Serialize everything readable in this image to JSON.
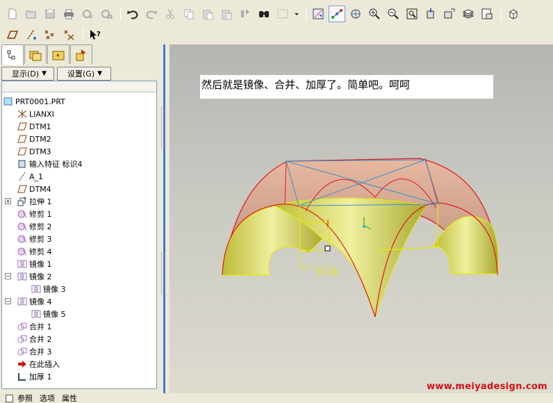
{
  "toolbar": {
    "row1": [
      "new-icon",
      "open-icon",
      "save-icon",
      "print-icon",
      "send-icon",
      "email-icon",
      "undo-icon",
      "redo-icon",
      "cut-icon",
      "copy-icon",
      "paste-icon",
      "paste-special-icon",
      "regenerate-icon",
      "find-icon",
      "select-box-icon",
      "repaint-icon",
      "spin-center-icon",
      "orient-icon",
      "zoom-in-icon",
      "zoom-out-icon",
      "refit-icon",
      "reorient-icon",
      "saved-views-icon",
      "layers-icon",
      "model-tree-icon",
      "window-icon"
    ],
    "row2": [
      "datum-plane-icon",
      "datum-axis-icon",
      "datum-point-icon",
      "coordinate-system-icon",
      "context-help-icon"
    ]
  },
  "left_panel": {
    "tabs": [
      "model-tree-tab",
      "folder-browser-tab",
      "favorites-tab",
      "connections-tab"
    ],
    "show_menu": "显示(D)",
    "settings_menu": "设置(G)",
    "tree": [
      {
        "label": "PRT0001.PRT",
        "icon": "part-icon",
        "indent": 0
      },
      {
        "label": "LIANXI",
        "icon": "csys-icon",
        "indent": 1
      },
      {
        "label": "DTM1",
        "icon": "datum-plane-icon",
        "indent": 1
      },
      {
        "label": "DTM2",
        "icon": "datum-plane-icon",
        "indent": 1
      },
      {
        "label": "DTM3",
        "icon": "datum-plane-icon",
        "indent": 1
      },
      {
        "label": "输入特征 标识4",
        "icon": "import-feature-icon",
        "indent": 1
      },
      {
        "label": "A_1",
        "icon": "datum-axis-icon",
        "indent": 1
      },
      {
        "label": "DTM4",
        "icon": "datum-plane-icon",
        "indent": 1
      },
      {
        "label": "拉伸 1",
        "icon": "extrude-icon",
        "indent": 1,
        "expander": "+"
      },
      {
        "label": "修剪 1",
        "icon": "trim-icon",
        "indent": 1
      },
      {
        "label": "修剪 2",
        "icon": "trim-icon",
        "indent": 1
      },
      {
        "label": "修剪 3",
        "icon": "trim-icon",
        "indent": 1
      },
      {
        "label": "修剪 4",
        "icon": "trim-icon",
        "indent": 1
      },
      {
        "label": "镜像 1",
        "icon": "mirror-icon",
        "indent": 1
      },
      {
        "label": "镜像 2",
        "icon": "mirror-icon",
        "indent": 1,
        "expander": "−"
      },
      {
        "label": "镜像 3",
        "icon": "mirror-icon",
        "indent": 2
      },
      {
        "label": "镜像 4",
        "icon": "mirror-icon",
        "indent": 1,
        "expander": "−"
      },
      {
        "label": "镜像 5",
        "icon": "mirror-icon",
        "indent": 2
      },
      {
        "label": "合并 1",
        "icon": "merge-icon",
        "indent": 1
      },
      {
        "label": "合并 2",
        "icon": "merge-icon",
        "indent": 1
      },
      {
        "label": "合并 3",
        "icon": "merge-icon",
        "indent": 1
      },
      {
        "label": "在此插入",
        "icon": "insert-here-icon",
        "indent": 1
      },
      {
        "label": "加厚 1",
        "icon": "thicken-icon",
        "indent": 1
      }
    ]
  },
  "viewport": {
    "note": "然后就是镜像、合并、加厚了。简单吧。呵呵",
    "dimension": "24.00",
    "watermark": "www.meiyadesign.com"
  },
  "status_bar": {
    "items": [
      "参照",
      "选项",
      "属性"
    ]
  },
  "colors": {
    "surface_yellow": "#d8d860",
    "surface_pink": "#d8a890",
    "edge_red": "#e01818",
    "datum_blue": "#3a90c8",
    "watermark": "#d41010"
  }
}
